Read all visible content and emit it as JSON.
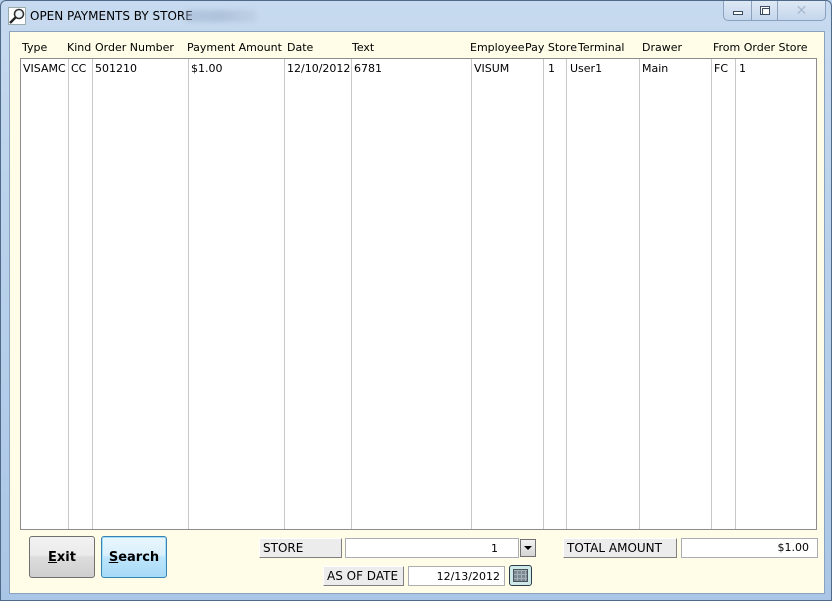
{
  "window": {
    "title": "OPEN PAYMENTS BY STORE",
    "icon": "magnifier-icon",
    "controls": [
      "minimize",
      "maximize",
      "close"
    ]
  },
  "grid": {
    "columns": [
      "Type",
      "Kind",
      "Order Number",
      "Payment Amount",
      "Date",
      "Text",
      "Employee",
      "Pay Store",
      "Terminal",
      "Drawer",
      "From Order Store"
    ],
    "rows": [
      {
        "type": "VISAMC",
        "kind": "CC",
        "order_number": "501210",
        "payment_amount": "$1.00",
        "date": "12/10/2012",
        "text": "6781",
        "employee": "VISUM",
        "pay_store": "1",
        "terminal": "User1",
        "drawer": "Main",
        "from_order_store_code": "FC",
        "from_order_store": "1"
      }
    ]
  },
  "footer": {
    "exit_label": "Exit",
    "exit_mnemonic": "E",
    "exit_rest": "xit",
    "search_label": "Search",
    "search_mnemonic": "S",
    "search_rest": "earch",
    "store_label": "STORE",
    "store_value": "1",
    "as_of_date_label": "AS OF DATE",
    "as_of_date_value": "12/13/2012",
    "total_amount_label": "TOTAL AMOUNT",
    "total_amount_value": "$1.00"
  }
}
